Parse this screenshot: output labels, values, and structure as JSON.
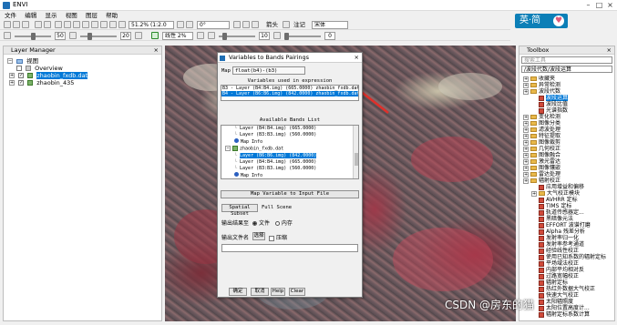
{
  "window": {
    "title": "ENVI"
  },
  "menu": [
    "文件",
    "编辑",
    "显示",
    "视图",
    "图层",
    "帮助"
  ],
  "toolbar1": {
    "zoom_combo": "51.2% (1:2.0",
    "rotate_combo": "0°",
    "arrow_label": "箭头",
    "annotate_label": "注记",
    "font_combo": "宋体"
  },
  "toolbar2": {
    "brightness": "50",
    "contrast": "20",
    "stretch_combo": "线性 2%",
    "sharpen": "10",
    "transparency": "0"
  },
  "badge": {
    "text": "英·简"
  },
  "layer_manager": {
    "title": "Layer Manager",
    "root": "视图",
    "items": [
      {
        "label": "Overview",
        "checked": false
      },
      {
        "label": "zhaobin_fxdb.dat",
        "checked": true,
        "selected": true
      },
      {
        "label": "zhaobin_435",
        "checked": true,
        "selected": false
      }
    ]
  },
  "dialog": {
    "title": "Variables to Bands Pairings",
    "map_label": "Map",
    "expression": "float(b4)-(b3)",
    "variables_header": "Variables used in expression",
    "variables": [
      {
        "text": "B3 - Layer (B4:B4.img) (665.0000) zhaobin_fxdb.dat",
        "selected": false
      },
      {
        "text": "B4 - Layer (B6:B6.img) (842.0000) zhaobin_fxdb.dat",
        "selected": true
      }
    ],
    "bands_header": "Available Bands List",
    "bands": [
      {
        "text": "Layer (B4:B4.img) (665.0000)",
        "indent": 2,
        "type": "band",
        "selected": false
      },
      {
        "text": "Layer (B3:B3.img) (560.0000)",
        "indent": 2,
        "type": "band",
        "selected": false
      },
      {
        "text": "Map Info",
        "indent": 2,
        "type": "map",
        "selected": false
      },
      {
        "text": "zhaobin_fxdb.dat",
        "indent": 1,
        "type": "file",
        "selected": false
      },
      {
        "text": "Layer (B6:B6.img) (842.0000)",
        "indent": 2,
        "type": "band",
        "selected": true
      },
      {
        "text": "Layer (B4:B4.img) (665.0000)",
        "indent": 2,
        "type": "band",
        "selected": false
      },
      {
        "text": "Layer (B3:B3.img) (560.0000)",
        "indent": 2,
        "type": "band",
        "selected": false
      },
      {
        "text": "Map Info",
        "indent": 2,
        "type": "map",
        "selected": false
      }
    ],
    "map_variable_button": "Map Variable to Input File",
    "spatial_subset_button": "Spatial Subset",
    "spatial_subset_value": "Full Scene",
    "output_label": "输出结果至",
    "output_file": "文件",
    "output_memory": "内存",
    "output_filename_label": "输出文件名",
    "choose_button": "选择",
    "compress_label": "压缩",
    "ok_button": "确定",
    "cancel_button": "取消",
    "help_button": "Help",
    "clear_button": "Clear"
  },
  "toolbox": {
    "title": "Toolbox",
    "search_placeholder": "搜索工具",
    "path": "/波段代数/波段运算",
    "items": [
      {
        "label": "收藏夹",
        "level": 0,
        "type": "folder"
      },
      {
        "label": "异常检测",
        "level": 0,
        "type": "folder"
      },
      {
        "label": "波段代数",
        "level": 0,
        "type": "folder"
      },
      {
        "label": "波段运算",
        "level": 1,
        "type": "tool",
        "selected": true
      },
      {
        "label": "波段比值",
        "level": 1,
        "type": "tool"
      },
      {
        "label": "光谱指数",
        "level": 1,
        "type": "tool"
      },
      {
        "label": "变化检测",
        "level": 0,
        "type": "folder"
      },
      {
        "label": "图像分类",
        "level": 0,
        "type": "folder"
      },
      {
        "label": "滤波处理",
        "level": 0,
        "type": "folder"
      },
      {
        "label": "特征提取",
        "level": 0,
        "type": "folder"
      },
      {
        "label": "图像裁剪",
        "level": 0,
        "type": "folder"
      },
      {
        "label": "几何校正",
        "level": 0,
        "type": "folder"
      },
      {
        "label": "图像融合",
        "level": 0,
        "type": "folder"
      },
      {
        "label": "激光雷达",
        "level": 0,
        "type": "folder"
      },
      {
        "label": "图像镶嵌",
        "level": 0,
        "type": "folder"
      },
      {
        "label": "雷达处理",
        "level": 0,
        "type": "folder"
      },
      {
        "label": "辐射校正",
        "level": 0,
        "type": "folder"
      },
      {
        "label": "应用增益和偏移",
        "level": 1,
        "type": "tool"
      },
      {
        "label": "大气校正模块",
        "level": 1,
        "type": "folder"
      },
      {
        "label": "AVHRR 定标",
        "level": 1,
        "type": "tool"
      },
      {
        "label": "TIMS 定标",
        "level": 1,
        "type": "tool"
      },
      {
        "label": "轨道传感器定...",
        "level": 1,
        "type": "tool"
      },
      {
        "label": "黑暗像元法",
        "level": 1,
        "type": "tool"
      },
      {
        "label": "EFFORT 波谱打磨",
        "level": 1,
        "type": "tool"
      },
      {
        "label": "Alpha 残差分析",
        "level": 1,
        "type": "tool"
      },
      {
        "label": "发射率归一化",
        "level": 1,
        "type": "tool"
      },
      {
        "label": "发射率参考通道",
        "level": 1,
        "type": "tool"
      },
      {
        "label": "经验线性校正",
        "level": 1,
        "type": "tool"
      },
      {
        "label": "使用已知系数的辐射定标",
        "level": 1,
        "type": "tool"
      },
      {
        "label": "平场域法校正",
        "level": 1,
        "type": "tool"
      },
      {
        "label": "内部平均相对反",
        "level": 1,
        "type": "tool"
      },
      {
        "label": "过路宽幅校正",
        "level": 1,
        "type": "tool"
      },
      {
        "label": "辐射定标",
        "level": 1,
        "type": "tool"
      },
      {
        "label": "热红外数据大气校正",
        "level": 1,
        "type": "tool"
      },
      {
        "label": "快速大气校正",
        "level": 1,
        "type": "tool"
      },
      {
        "label": "太阳辐照度",
        "level": 1,
        "type": "tool"
      },
      {
        "label": "太阳位置高度计...",
        "level": 1,
        "type": "tool"
      },
      {
        "label": "辐射定标系数计算",
        "level": 1,
        "type": "tool"
      }
    ]
  },
  "watermark": "CSDN @房东的猫",
  "colors": {
    "selection": "#0078d7",
    "badge": "#0c7fb7",
    "arrow": "#e0302a"
  }
}
